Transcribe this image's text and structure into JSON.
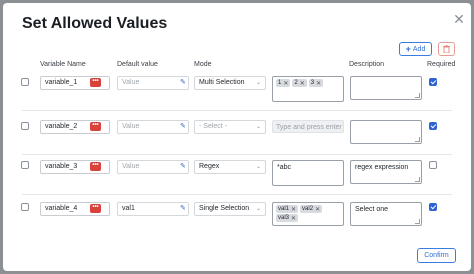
{
  "dialog": {
    "title": "Set Allowed Values",
    "add_label": "Add",
    "confirm_label": "Confirm"
  },
  "columns": {
    "variable_name": "Variable Name",
    "default_value": "Default value",
    "mode": "Mode",
    "description": "Description",
    "required": "Required"
  },
  "rows": [
    {
      "selected": false,
      "name": "variable_1",
      "default_value": "",
      "default_placeholder": "Value",
      "mode": "Multi Selection",
      "allowed": [
        "1",
        "2",
        "3"
      ],
      "allowed_placeholder": "",
      "description": "",
      "required": true
    },
    {
      "selected": false,
      "name": "variable_2",
      "default_value": "",
      "default_placeholder": "Value",
      "mode": "",
      "mode_placeholder": "- Select -",
      "allowed": [],
      "allowed_placeholder": "Type and press enter b",
      "description": "",
      "required": true
    },
    {
      "selected": false,
      "name": "variable_3",
      "default_value": "",
      "default_placeholder": "Value",
      "mode": "Regex",
      "allowed_text": "*abc",
      "description": "regex expression",
      "required": false
    },
    {
      "selected": false,
      "name": "variable_4",
      "default_value": "val1",
      "default_placeholder": "",
      "mode": "Single Selection",
      "allowed": [
        "val1",
        "val2",
        "val3"
      ],
      "description": "Select one",
      "required": true
    }
  ],
  "colors": {
    "accent": "#2f63d0",
    "variable_icon": "#d9423a",
    "delete_border": "#e89b8f"
  }
}
